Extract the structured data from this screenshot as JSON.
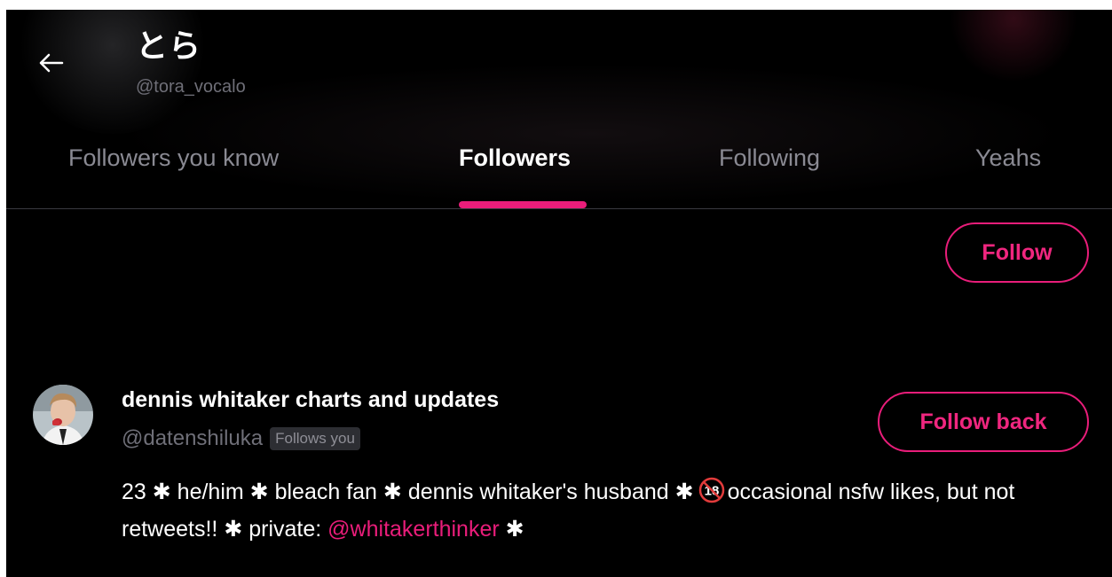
{
  "header": {
    "title": "とら",
    "handle": "@tora_vocalo"
  },
  "tabs": [
    {
      "label": "Followers you know",
      "active": false
    },
    {
      "label": "Followers",
      "active": true
    },
    {
      "label": "Following",
      "active": false
    },
    {
      "label": "Yeahs",
      "active": false
    }
  ],
  "first_item": {
    "follow_label": "Follow"
  },
  "user": {
    "name": "dennis whitaker charts and updates",
    "handle": "@datenshiluka",
    "badge": "Follows you",
    "follow_back_label": "Follow back",
    "bio": {
      "star": "✱",
      "p1": "23",
      "p2": "he/him",
      "p3": "bleach fan",
      "p4": "dennis whitaker's husband",
      "p5": "occasional nsfw likes, but not retweets!!",
      "p6": "private:",
      "mention": "@whitakerthinker",
      "age_icon": "18"
    }
  },
  "colors": {
    "background": "#000000",
    "accent": "#e91d7a",
    "muted_text": "#6f6f78",
    "inactive_tab": "#8a8a93"
  },
  "icons": [
    "back-arrow-icon",
    "no-under-18-icon"
  ]
}
